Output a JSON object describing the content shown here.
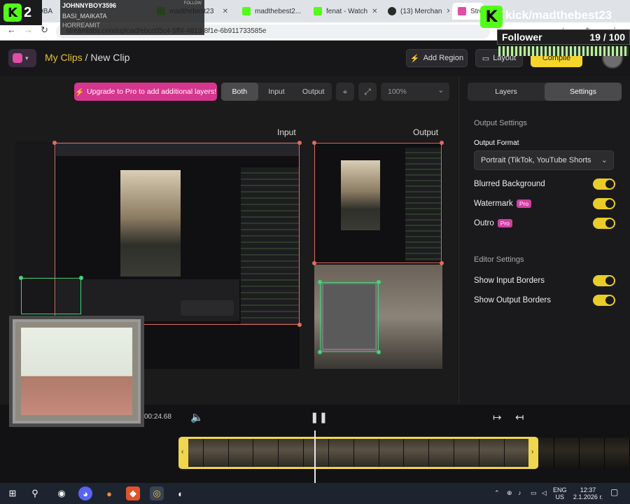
{
  "browser": {
    "tabs": [
      {
        "label": "TOBA",
        "color": "#53fc18"
      },
      {
        "label": "madthebest23",
        "color": "#53fc18"
      },
      {
        "label": "madthebest2...",
        "color": "#53fc18"
      },
      {
        "label": "fenat - Watch",
        "color": "#53fc18"
      },
      {
        "label": "(13) Merchan",
        "color": "#1f1f1f"
      },
      {
        "label": "Strea",
        "color": "#e14ea6"
      }
    ],
    "url": "streamlabs.com/upload/ebcc05c4-5ff4-4813-8f1e-6b911733585e"
  },
  "app": {
    "breadcrumb_link": "My Clips",
    "breadcrumb_sep": " / ",
    "breadcrumb_current": "New Clip",
    "add_region": "Add Region",
    "layout": "Layout",
    "compile": "Compile"
  },
  "toolbar": {
    "upgrade": "Upgrade to Pro to add additional layers!",
    "view_modes": [
      "Both",
      "Input",
      "Output"
    ],
    "zoom": "100%"
  },
  "preview": {
    "input_label": "Input",
    "output_label": "Output"
  },
  "panel": {
    "tab_layers": "Layers",
    "tab_settings": "Settings",
    "output_settings": "Output Settings",
    "output_format_label": "Output Format",
    "output_format_value": "Portrait (TikTok, YouTube Shorts",
    "blurred_background": "Blurred Background",
    "watermark": "Watermark",
    "outro": "Outro",
    "pro": "Pro",
    "editor_settings": "Editor Settings",
    "show_input_borders": "Show Input Borders",
    "show_output_borders": "Show Output Borders"
  },
  "timeline": {
    "timecode": "00:24.68"
  },
  "overlays": {
    "kick_count": "2",
    "chat_user": "JOHNNYBOY3596",
    "chat_follow": "FOLLOW",
    "chat_line2": "BASI_MAIKATA",
    "chat_line3": "HORREAMIT",
    "channel": "kick/madthebest23",
    "goal_label": "Follower",
    "goal_value": "19 / 100",
    "goal_progress": 0.19
  },
  "taskbar": {
    "lang_top": "ENG",
    "lang_bottom": "US",
    "time": "12:37",
    "date": "2.1.2026 г."
  },
  "colors": {
    "accent_yellow": "#f5d52a",
    "pro_pink": "#d6368d",
    "kick_green": "#53fc18",
    "input_border": "#e26b5c",
    "output_border": "#44d37a"
  }
}
